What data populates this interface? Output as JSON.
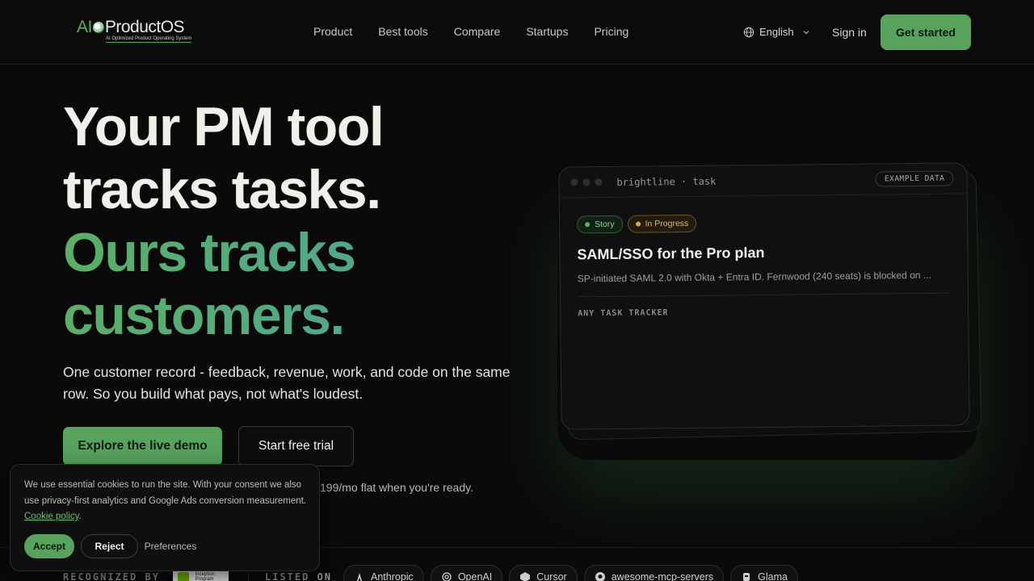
{
  "brand": {
    "logo_ai": "AI",
    "logo_name": "ProductOS",
    "logo_tagline": "AI Optimized Product Operating System",
    "accent_color": "#57a35e"
  },
  "nav": {
    "items": [
      "Product",
      "Best tools",
      "Compare",
      "Startups",
      "Pricing"
    ],
    "language": "English",
    "sign_in": "Sign in",
    "get_started": "Get started"
  },
  "hero": {
    "title_line1": "Your PM tool",
    "title_line2": "tracks tasks.",
    "title_line3": "Ours tracks",
    "title_line4": "customers.",
    "subtitle": "One customer record - feedback, revenue, work, and code on the same row. So you build what pays, not what's loudest.",
    "primary_cta": "Explore the live demo",
    "secondary_cta": "Start free trial",
    "pricing_note": "199/mo flat when you're ready."
  },
  "card": {
    "path": "brightline · task",
    "badge": "EXAMPLE DATA",
    "chip_type": "Story",
    "chip_status": "In Progress",
    "title": "SAML/SSO for the Pro plan",
    "description": "SP-initiated SAML 2.0 with Okta + Entra ID. Fernwood (240 seats) is blocked on ...",
    "footer_label": "ANY TASK TRACKER"
  },
  "strip": {
    "recognized_label": "RECOGNIZED BY",
    "nvidia_badge_text": "Inception Program",
    "listed_label": "LISTED ON",
    "listings": [
      {
        "name": "Anthropic",
        "icon": "anthropic-icon"
      },
      {
        "name": "OpenAI",
        "icon": "openai-icon"
      },
      {
        "name": "Cursor",
        "icon": "cursor-icon"
      },
      {
        "name": "awesome-mcp-servers",
        "icon": "github-icon"
      },
      {
        "name": "Glama",
        "icon": "glama-icon"
      }
    ]
  },
  "cookie": {
    "text": "We use essential cookies to run the site. With your consent we also use privacy-first analytics and Google Ads conversion measurement.",
    "link": "Cookie policy",
    "accept": "Accept",
    "reject": "Reject",
    "preferences": "Preferences"
  }
}
